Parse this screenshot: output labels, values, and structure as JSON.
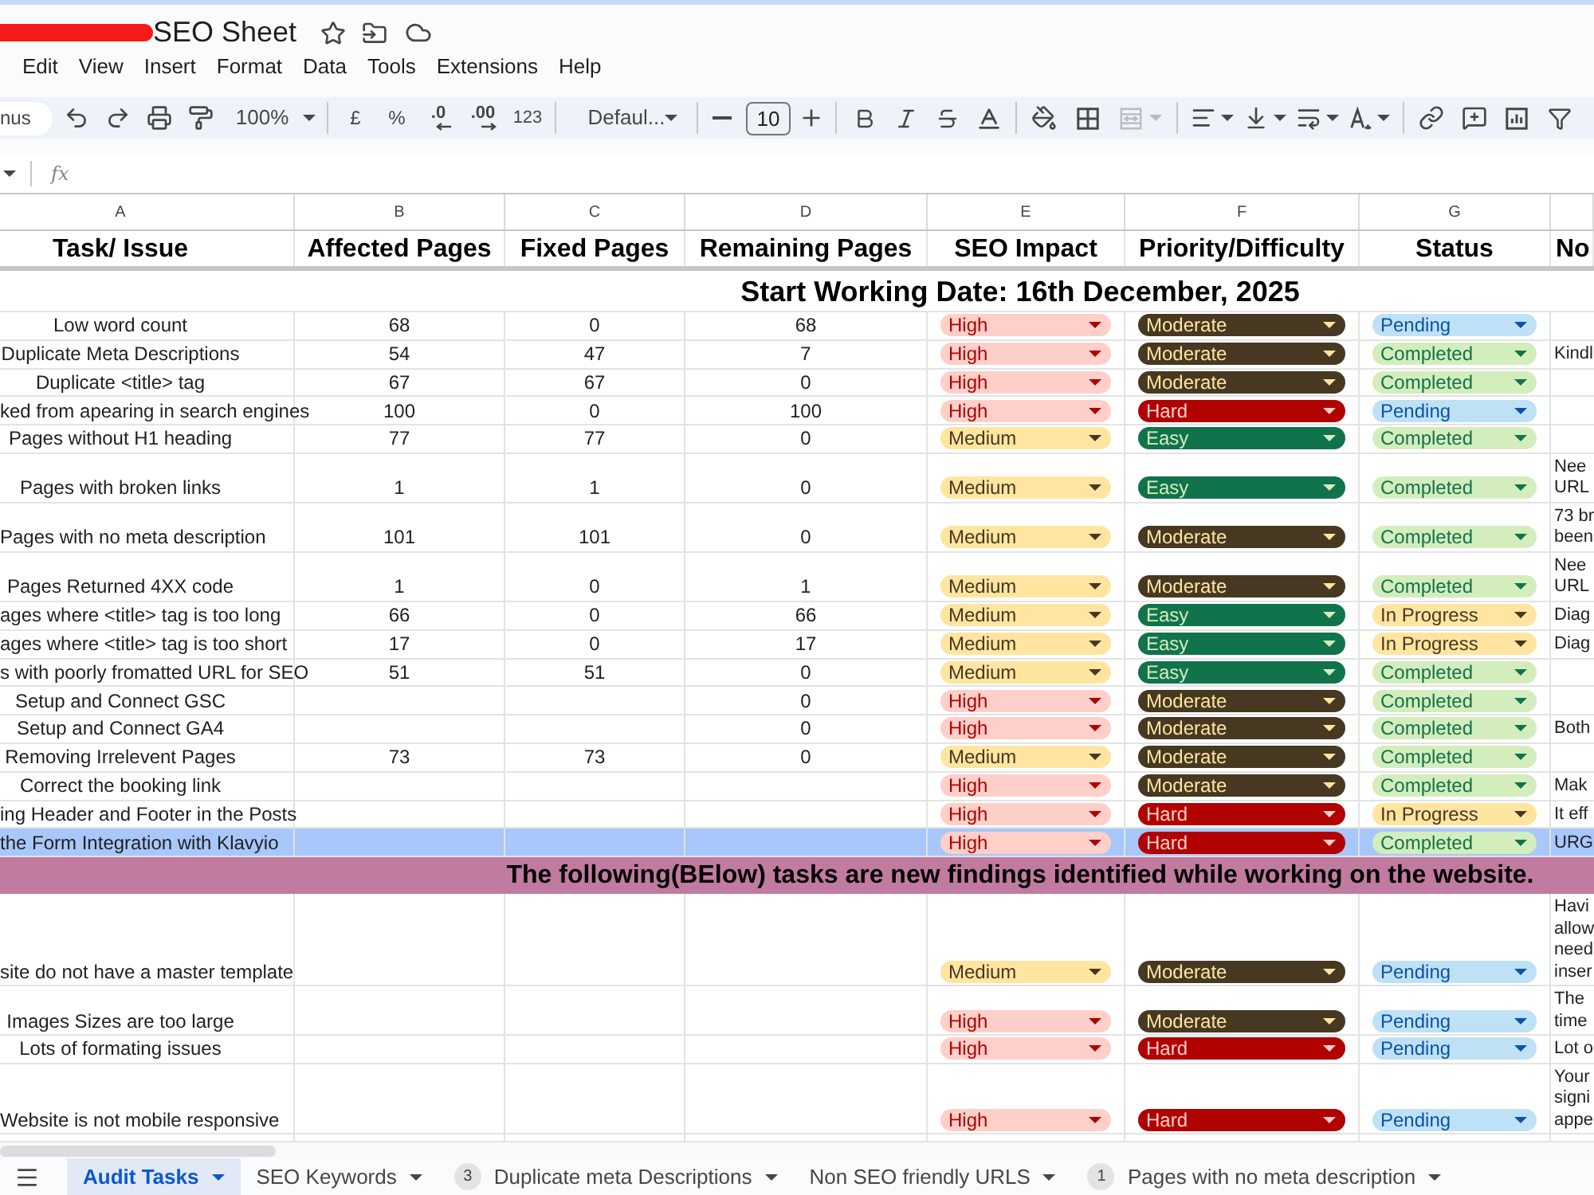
{
  "document": {
    "title": "SEO Sheet"
  },
  "menu": [
    "Edit",
    "View",
    "Insert",
    "Format",
    "Data",
    "Tools",
    "Extensions",
    "Help"
  ],
  "toolbar": {
    "menus_search": "nus",
    "zoom": "100%",
    "currency": "£",
    "percent": "%",
    "decrease_decimal": ".0",
    "increase_decimal": ".00",
    "number_format": "123",
    "font": "Defaul...",
    "font_size": "10"
  },
  "formula_bar": {
    "label": "fx"
  },
  "columns": [
    "A",
    "B",
    "C",
    "D",
    "E",
    "F",
    "G"
  ],
  "header": [
    "Task/ Issue",
    "Affected Pages",
    "Fixed Pages",
    "Remaining Pages",
    "SEO Impact",
    "Priority/Difficulty",
    "Status",
    "No"
  ],
  "date_banner": "Start Working Date: 16th December, 2025",
  "rows": [
    {
      "task": "Low word count",
      "affected": "68",
      "fixed": "0",
      "remaining": "68",
      "impact": {
        "label": "High",
        "color": "#ffcfc9"
      },
      "priority": {
        "label": "Moderate",
        "color": "#473822"
      },
      "status": {
        "label": "Pending",
        "color": "#bfe1f6"
      },
      "selected": false
    },
    {
      "task": "Duplicate Meta Descriptions",
      "affected": "54",
      "fixed": "47",
      "remaining": "7",
      "impact": {
        "label": "High",
        "color": "#ffcfc9"
      },
      "priority": {
        "label": "Moderate",
        "color": "#473822"
      },
      "status": {
        "label": "Completed",
        "color": "#d4edbc"
      },
      "note": "Kindl",
      "selected": false
    },
    {
      "task": "Duplicate <title> tag",
      "affected": "67",
      "fixed": "67",
      "remaining": "0",
      "impact": {
        "label": "High",
        "color": "#ffcfc9"
      },
      "priority": {
        "label": "Moderate",
        "color": "#473822"
      },
      "status": {
        "label": "Completed",
        "color": "#d4edbc"
      },
      "selected": false
    },
    {
      "task": "ked from apearing in search engines",
      "affected": "100",
      "fixed": "0",
      "remaining": "100",
      "impact": {
        "label": "High",
        "color": "#ffcfc9"
      },
      "priority": {
        "label": "Hard",
        "color": "#b10202"
      },
      "status": {
        "label": "Pending",
        "color": "#bfe1f6"
      },
      "selected": false
    },
    {
      "task": "Pages without H1 heading",
      "affected": "77",
      "fixed": "77",
      "remaining": "0",
      "impact": {
        "label": "Medium",
        "color": "#ffe5a0"
      },
      "priority": {
        "label": "Easy",
        "color": "#11734b"
      },
      "status": {
        "label": "Completed",
        "color": "#d4edbc"
      },
      "selected": false
    },
    {
      "task": "Pages with broken links",
      "affected": "1",
      "fixed": "1",
      "remaining": "0",
      "impact": {
        "label": "Medium",
        "color": "#ffe5a0"
      },
      "priority": {
        "label": "Easy",
        "color": "#11734b"
      },
      "status": {
        "label": "Completed",
        "color": "#d4edbc"
      },
      "note": "Nee\nURL",
      "selected": false
    },
    {
      "task": "Pages with no meta description",
      "affected": "101",
      "fixed": "101",
      "remaining": "0",
      "impact": {
        "label": "Medium",
        "color": "#ffe5a0"
      },
      "priority": {
        "label": "Moderate",
        "color": "#473822"
      },
      "status": {
        "label": "Completed",
        "color": "#d4edbc"
      },
      "note": "73 br\nbeen",
      "selected": false
    },
    {
      "task": "Pages Returned 4XX code",
      "affected": "1",
      "fixed": "0",
      "remaining": "1",
      "impact": {
        "label": "Medium",
        "color": "#ffe5a0"
      },
      "priority": {
        "label": "Moderate",
        "color": "#473822"
      },
      "status": {
        "label": "Completed",
        "color": "#d4edbc"
      },
      "note": "Nee\nURL",
      "selected": false
    },
    {
      "task": "ages where <title> tag is too long",
      "affected": "66",
      "fixed": "0",
      "remaining": "66",
      "impact": {
        "label": "Medium",
        "color": "#ffe5a0"
      },
      "priority": {
        "label": "Easy",
        "color": "#11734b"
      },
      "status": {
        "label": "In Progress",
        "color": "#ffe5a0"
      },
      "note": "Diag",
      "selected": false
    },
    {
      "task": "ages where <title> tag is too short",
      "affected": "17",
      "fixed": "0",
      "remaining": "17",
      "impact": {
        "label": "Medium",
        "color": "#ffe5a0"
      },
      "priority": {
        "label": "Easy",
        "color": "#11734b"
      },
      "status": {
        "label": "In Progress",
        "color": "#ffe5a0"
      },
      "note": "Diag",
      "selected": false
    },
    {
      "task": "s with poorly fromatted URL for SEO",
      "affected": "51",
      "fixed": "51",
      "remaining": "0",
      "impact": {
        "label": "Medium",
        "color": "#ffe5a0"
      },
      "priority": {
        "label": "Easy",
        "color": "#11734b"
      },
      "status": {
        "label": "Completed",
        "color": "#d4edbc"
      },
      "selected": false
    },
    {
      "task": "Setup and Connect GSC",
      "remaining": "0",
      "impact": {
        "label": "High",
        "color": "#ffcfc9"
      },
      "priority": {
        "label": "Moderate",
        "color": "#473822"
      },
      "status": {
        "label": "Completed",
        "color": "#d4edbc"
      },
      "selected": false
    },
    {
      "task": "Setup and Connect GA4",
      "remaining": "0",
      "impact": {
        "label": "High",
        "color": "#ffcfc9"
      },
      "priority": {
        "label": "Moderate",
        "color": "#473822"
      },
      "status": {
        "label": "Completed",
        "color": "#d4edbc"
      },
      "note": "Both",
      "selected": false
    },
    {
      "task": "Removing Irrelevent Pages",
      "affected": "73",
      "fixed": "73",
      "remaining": "0",
      "impact": {
        "label": "Medium",
        "color": "#ffe5a0"
      },
      "priority": {
        "label": "Moderate",
        "color": "#473822"
      },
      "status": {
        "label": "Completed",
        "color": "#d4edbc"
      },
      "selected": false
    },
    {
      "task": "Correct the booking link",
      "impact": {
        "label": "High",
        "color": "#ffcfc9"
      },
      "priority": {
        "label": "Moderate",
        "color": "#473822"
      },
      "status": {
        "label": "Completed",
        "color": "#d4edbc"
      },
      "note": "Mak",
      "selected": false
    },
    {
      "task": "ing Header and Footer in the Posts",
      "impact": {
        "label": "High",
        "color": "#ffcfc9"
      },
      "priority": {
        "label": "Hard",
        "color": "#b10202"
      },
      "status": {
        "label": "In Progress",
        "color": "#ffe5a0"
      },
      "note": "It eff",
      "selected": false
    },
    {
      "task": "the Form Integration with Klavyio",
      "impact": {
        "label": "High",
        "color": "#ffcfc9"
      },
      "priority": {
        "label": "Hard",
        "color": "#b10202"
      },
      "status": {
        "label": "Completed",
        "color": "#d4edbc"
      },
      "note": "URG",
      "selected": true
    }
  ],
  "findings_banner": "The following(BElow) tasks are new findings identified while working on the website.",
  "new_rows": [
    {
      "task": "site do not have a master template",
      "impact": {
        "label": "Medium",
        "color": "#ffe5a0"
      },
      "priority": {
        "label": "Moderate",
        "color": "#473822"
      },
      "status": {
        "label": "Pending",
        "color": "#bfe1f6"
      },
      "note": "Havi\nallow\nneed\ninser",
      "selected": false
    },
    {
      "task": "Images Sizes are too large",
      "impact": {
        "label": "High",
        "color": "#ffcfc9"
      },
      "priority": {
        "label": "Moderate",
        "color": "#473822"
      },
      "status": {
        "label": "Pending",
        "color": "#bfe1f6"
      },
      "note": "The\ntime",
      "selected": false
    },
    {
      "task": "Lots of formating issues",
      "impact": {
        "label": "High",
        "color": "#ffcfc9"
      },
      "priority": {
        "label": "Hard",
        "color": "#b10202"
      },
      "status": {
        "label": "Pending",
        "color": "#bfe1f6"
      },
      "note": "Lot o",
      "selected": false
    },
    {
      "task": "Website is not mobile responsive",
      "impact": {
        "label": "High",
        "color": "#ffcfc9"
      },
      "priority": {
        "label": "Hard",
        "color": "#b10202"
      },
      "status": {
        "label": "Pending",
        "color": "#bfe1f6"
      },
      "note": "Your\nsigni\nappe",
      "selected": false
    }
  ],
  "sheet_tabs": [
    {
      "label": "Audit Tasks",
      "selected": true
    },
    {
      "label": "SEO Keywords",
      "selected": false
    },
    {
      "label": "Duplicate meta Descriptions",
      "badge": "3",
      "selected": false
    },
    {
      "label": "Non SEO friendly URLS",
      "selected": false
    },
    {
      "label": "Pages with no meta description",
      "badge": "1",
      "selected": false
    }
  ]
}
